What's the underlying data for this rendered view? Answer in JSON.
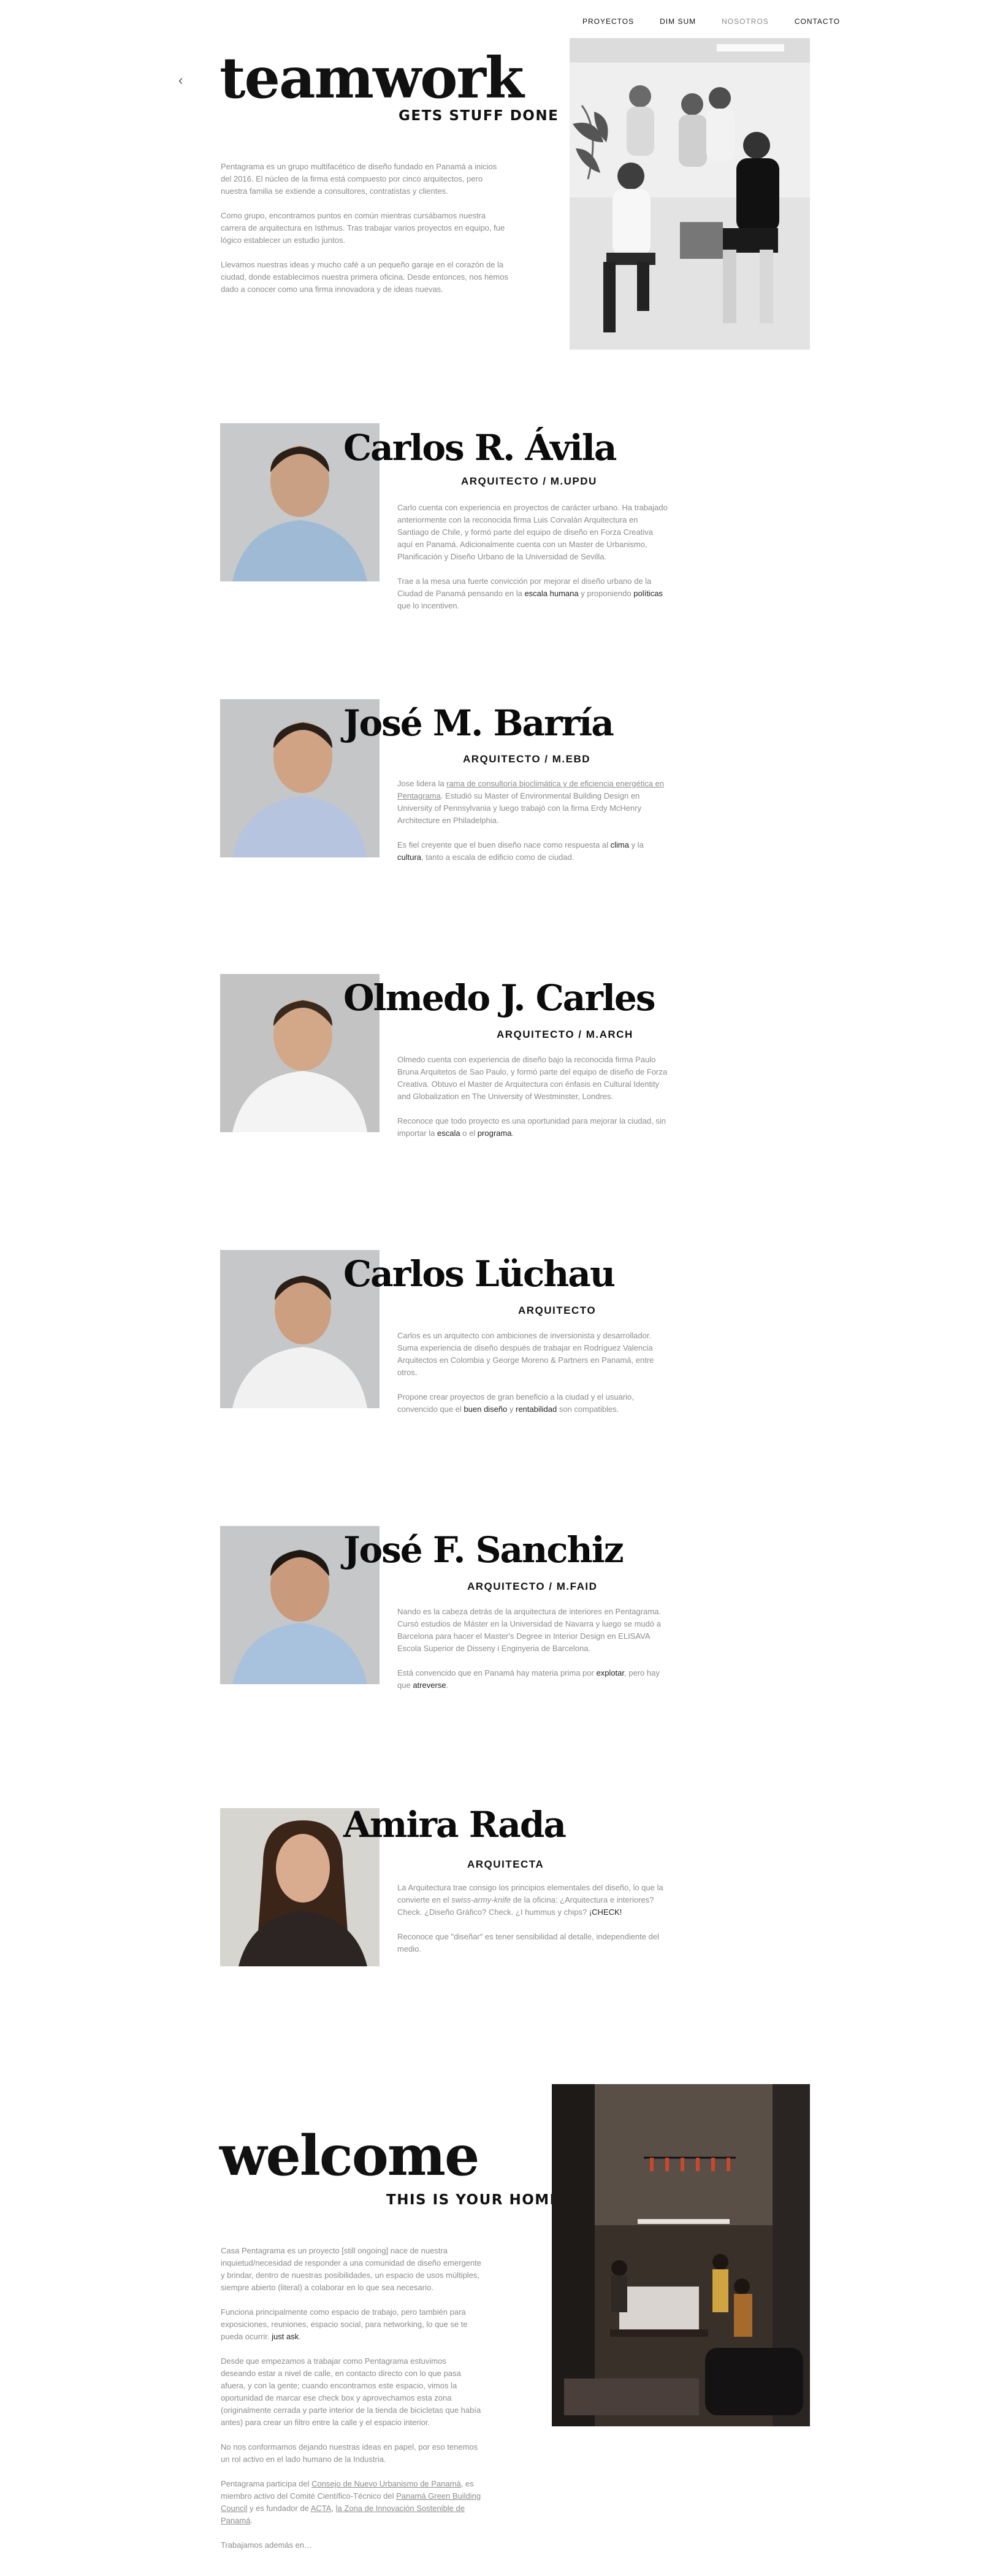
{
  "nav": {
    "items": [
      "PROYECTOS",
      "DIM SUM",
      "NOSOTROS",
      "CONTACTO"
    ]
  },
  "hero": {
    "title": "teamwork",
    "kicker": "GETS STUFF DONE",
    "paragraphs": [
      "Pentagrama es un grupo multifacético de diseño fundado en Panamá a inicios del 2016. El núcleo de la firma está compuesto por cinco arquitectos, pero nuestra familia se extiende a consultores, contratistas y clientes.",
      "Como grupo, encontramos puntos en común mientras cursábamos nuestra carrera de arquitectura en Isthmus. Tras trabajar varios proyectos en equipo, fue lógico establecer un estudio juntos.",
      "Llevamos nuestras ideas y mucho café a un pequeño garaje en el corazón de la ciudad, donde establecimos nuestra primera oficina. Desde entonces, nos hemos dado a conocer como una firma innovadora y de ideas nuevas."
    ]
  },
  "members": [
    {
      "name": "Carlos R. Ávila",
      "role": "ARQUITECTO / M.UPDU",
      "p1": "Carlo cuenta con experiencia en proyectos de carácter urbano. Ha trabajado anteriormente con la reconocida firma Luis Corvalán Arquitectura en Santiago de Chile, y formó parte del equipo de diseño en Forza Creativa aquí en Panamá. Adicionalmente cuenta con un Master de Urbanismo, Planificación y Diseño Urbano de la Universidad de Sevilla.",
      "p2a": "Trae a la mesa una fuerte convicción por mejorar el diseño urbano de la Ciudad de Panamá pensando en la ",
      "p2b": "escala humana",
      "p2c": " y proponiendo ",
      "p2d": "políticas",
      "p2e": " que lo incentiven."
    },
    {
      "name": "José M. Barría",
      "role": "ARQUITECTO / M.EBD",
      "p1a": "Jose lidera la ",
      "p1b": "rama de consultoría bioclimática y de eficiencia energética en Pentagrama",
      "p1c": ". Estudió su Master of Environmental Building Design en University of Pennsylvania y luego trabajó con la firma Erdy McHenry Architecture en Philadelphia.",
      "p2a": "Es fiel creyente que el buen diseño nace como respuesta al ",
      "p2b": "clima",
      "p2c": " y la ",
      "p2d": "cultura",
      "p2e": ", tanto a escala de edificio como de ciudad."
    },
    {
      "name": "Olmedo J. Carles",
      "role": "ARQUITECTO / M.ARCH",
      "p1": "Olmedo cuenta con experiencia de diseño bajo la reconocida firma Paulo Bruna Arquitetos de Sao Paulo, y formó parte del equipo de diseño de Forza Creativa. Obtuvo el Master de Arquitectura con énfasis en Cultural Identity and Globalization en The University of Westminster, Londres.",
      "p2a": "Reconoce que todo proyecto es una oportunidad para mejorar la ciudad, sin importar la ",
      "p2b": "escala",
      "p2c": " o el ",
      "p2d": "programa",
      "p2e": "."
    },
    {
      "name": "Carlos Lüchau",
      "role": "ARQUITECTO",
      "p1": "Carlos es un arquitecto con ambiciones de inversionista y desarrollador. Suma experiencia de diseño después de trabajar en Rodríguez Valencia Arquitectos en Colombia y George Moreno & Partners en Panamá, entre otros.",
      "p2a": "Propone crear proyectos de gran beneficio a la ciudad y el usuario, convencido que el ",
      "p2b": "buen diseño",
      "p2c": " y ",
      "p2d": "rentabilidad",
      "p2e": " son compatibles."
    },
    {
      "name": "José F. Sanchiz",
      "role": "ARQUITECTO / M.FAID",
      "p1": "Nando es la cabeza detrás de la arquitectura de interiores en Pentagrama. Cursó estudios de Máster en la Universidad de Navarra y luego se mudó a Barcelona para hacer el Master's Degree in Interior Design en ELISAVA Escola Superior de Disseny i Enginyeria de Barcelona.",
      "p2a": "Está convencido que en Panamá hay materia prima por ",
      "p2b": "explotar",
      "p2c": ", pero hay que ",
      "p2d": "atreverse",
      "p2e": "."
    },
    {
      "name": "Amira Rada",
      "role": "ARQUITECTA",
      "p1a": "La Arquitectura trae consigo los principios elementales del diseño, lo que la convierte en el ",
      "p1b": "swiss-army-knife",
      "p1c": " de la oficina: ¿Arquitectura e interiores? Check. ¿Diseño Gráfico? Check. ¿I hummus y chips? ",
      "p1d": "¡CHECK!",
      "p2": "Reconoce que \"diseñar\" es tener sensibilidad al detalle, independiente del medio."
    }
  ],
  "welcome": {
    "title": "welcome",
    "kicker": "THIS IS YOUR HOME",
    "p1": "Casa Pentagrama es un proyecto [still ongoing] nace de nuestra inquietud/necesidad de responder a una comunidad de diseño emergente y brindar, dentro de nuestras posibilidades, un espacio de usos múltiples, siempre abierto (literal) a colaborar en lo que sea necesario.",
    "p2a": "Funciona principalmente como espacio de trabajo, pero también para exposiciones, reuniones, espacio social, para networking, lo que se te pueda ocurrir. ",
    "p2b": "just ask",
    "p2c": ".",
    "p3": "Desde que empezamos a trabajar como Pentagrama estuvimos deseando estar a nivel de calle, en contacto directo con lo que pasa afuera, y con la gente; cuando encontramos este espacio, vimos la oportunidad de marcar ese check box y aprovechamos esta zona (originalmente cerrada y parte interior de la tienda de bicicletas que había antes) para crear un filtro entre la calle y el espacio interior.",
    "p4": "No nos conformamos dejando nuestras ideas en papel, por eso tenemos un rol activo en el lado humano de la Industria.",
    "p5a": "Pentagrama participa del ",
    "p5b": "Consejo de Nuevo Urbanismo de Panamá",
    "p5c": ", es miembro activo del Comité Científico-Técnico del ",
    "p5d": "Panamá Green Building Council",
    "p5e": " y es fundador de ",
    "p5f": "ACTA",
    "p5g": ", ",
    "p5h": "la Zona de Innovación Sostenible de Panamá",
    "p5i": ".",
    "p6": "Trabajamos además en…"
  },
  "images": {
    "team_photo": "team-group-photo-bw",
    "space_photo": "casa-pentagrama-interior-photo"
  },
  "colors": {
    "text_dark": "#111111",
    "text_muted": "#8c8c8c",
    "photo_bg": "#c9cacb"
  }
}
